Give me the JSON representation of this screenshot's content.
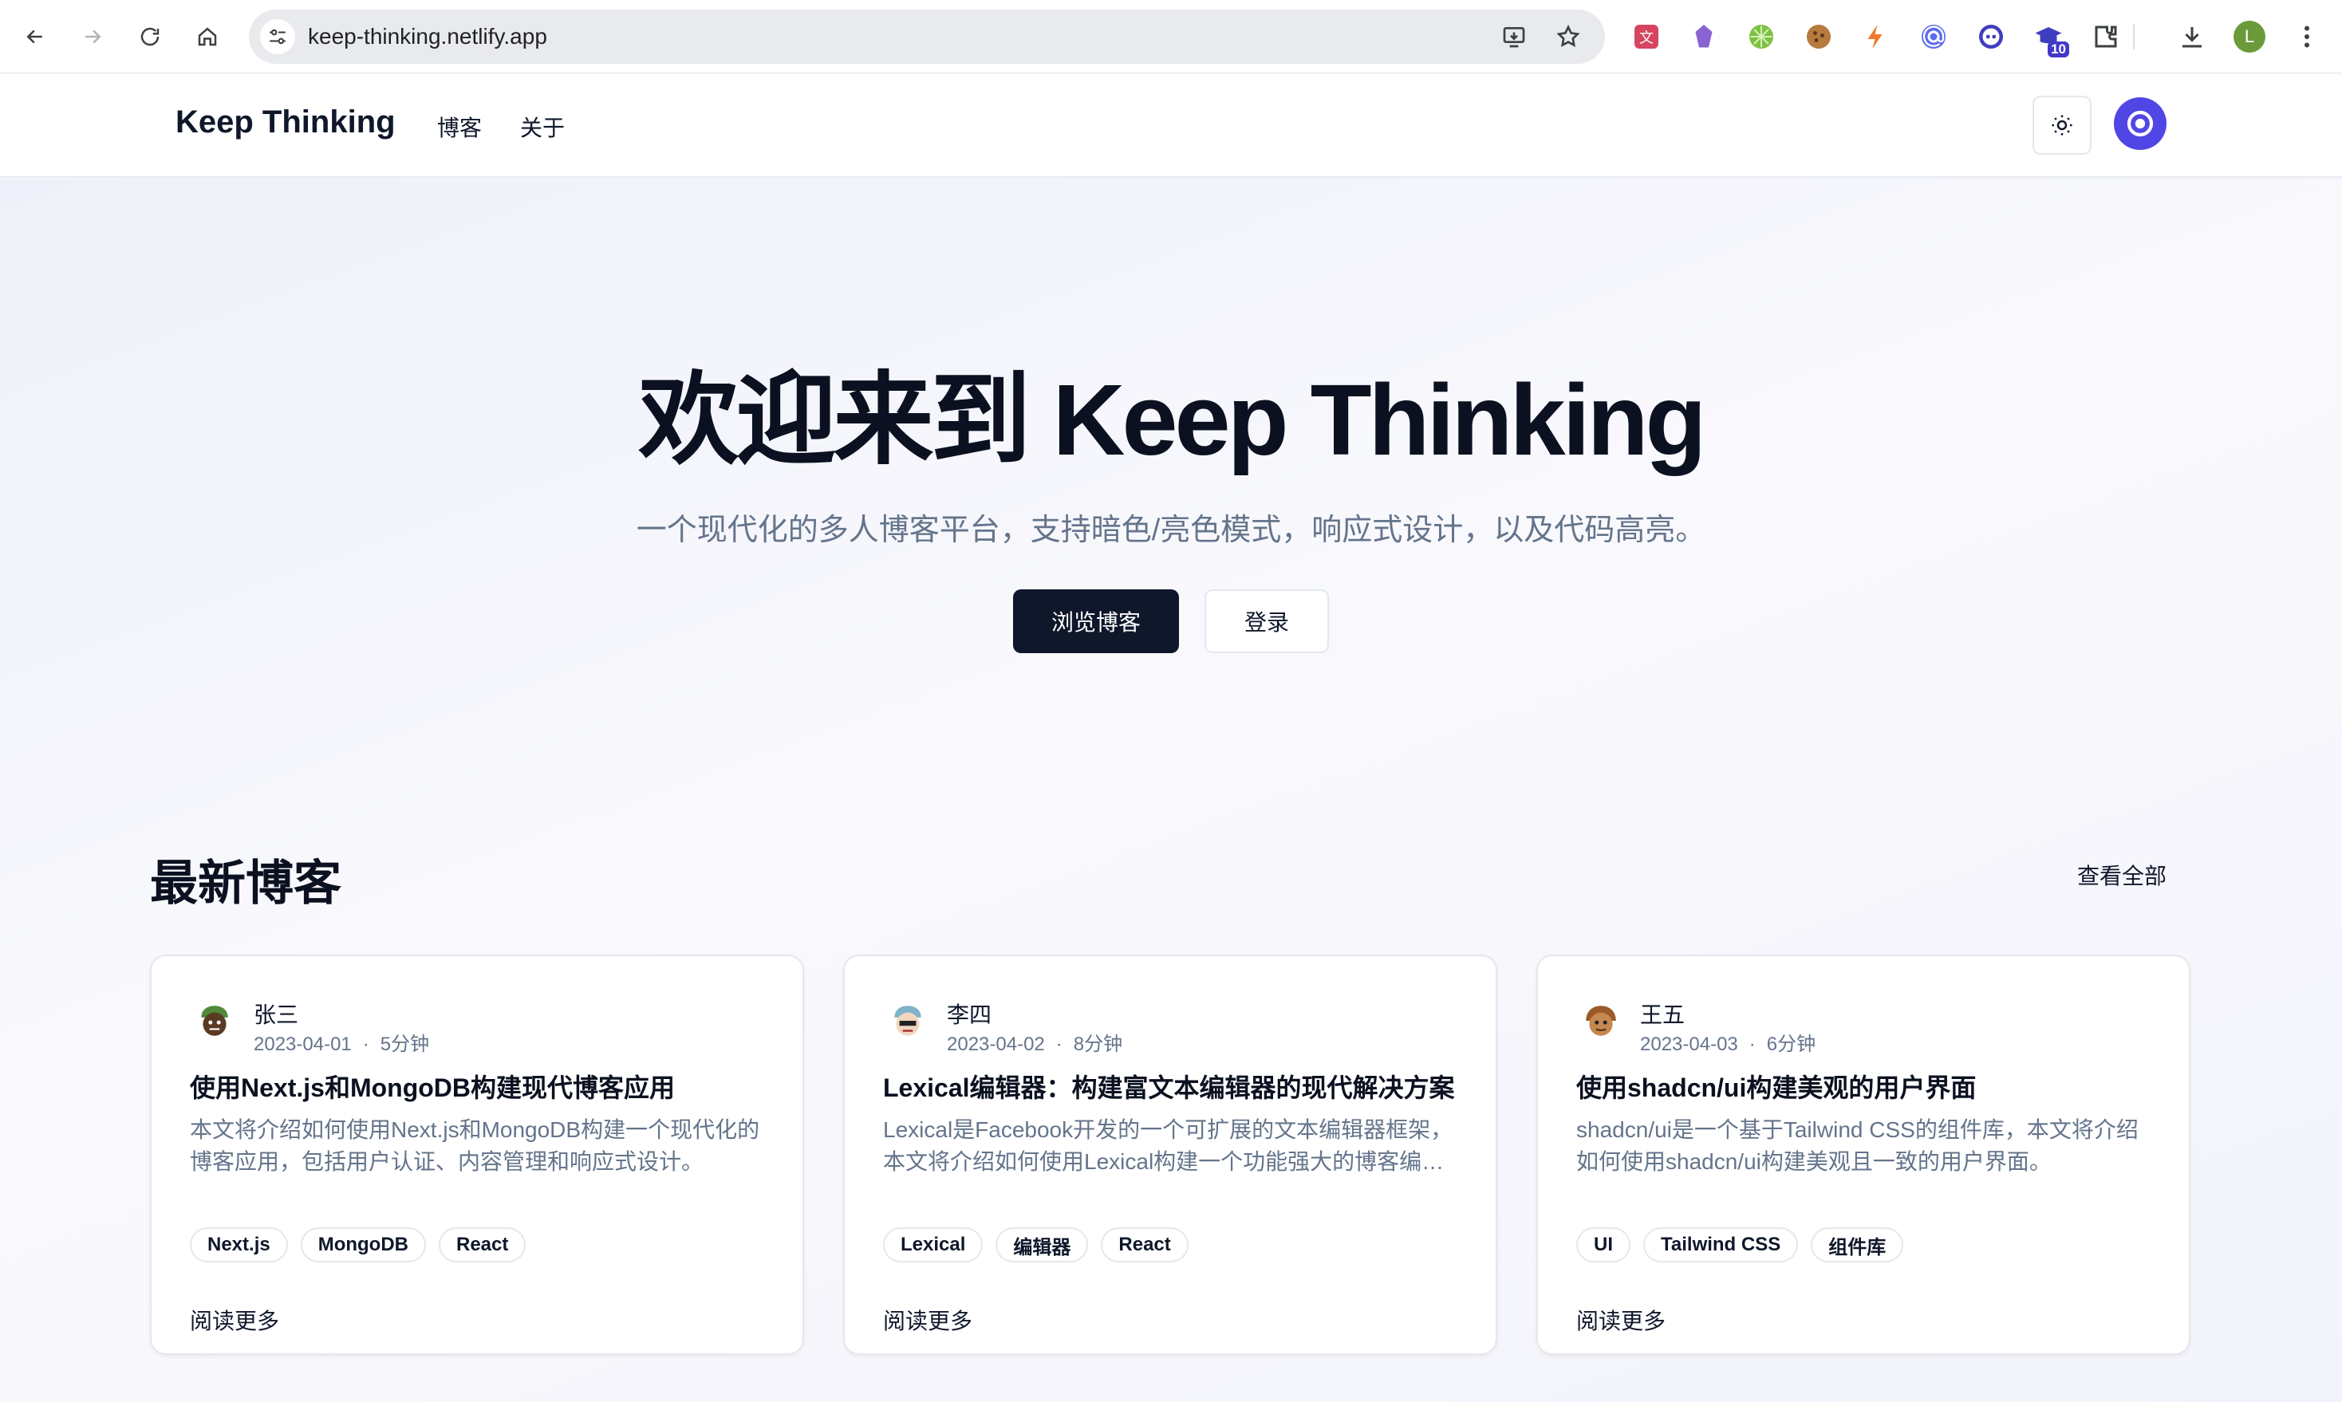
{
  "browser": {
    "url": "keep-thinking.netlify.app",
    "extension_badge": "10",
    "profile_initial": "L"
  },
  "header": {
    "brand": "Keep Thinking",
    "nav": [
      "博客",
      "关于"
    ]
  },
  "hero": {
    "title": "欢迎来到 Keep Thinking",
    "subtitle": "一个现代化的多人博客平台，支持暗色/亮色模式，响应式设计，以及代码高亮。",
    "primary_button": "浏览博客",
    "secondary_button": "登录"
  },
  "latest": {
    "title": "最新博客",
    "view_all": "查看全部",
    "read_more": "阅读更多",
    "posts": [
      {
        "author": "张三",
        "date": "2023-04-01",
        "read_time": "5分钟",
        "title": "使用Next.js和MongoDB构建现代博客应用",
        "excerpt": "本文将介绍如何使用Next.js和MongoDB构建一个现代化的博客应用，包括用户认证、内容管理和响应式设计。",
        "tags": [
          "Next.js",
          "MongoDB",
          "React"
        ],
        "avatar_color": "#4f8a3c"
      },
      {
        "author": "李四",
        "date": "2023-04-02",
        "read_time": "8分钟",
        "title": "Lexical编辑器：构建富文本编辑器的现代解决方案",
        "excerpt": "Lexical是Facebook开发的一个可扩展的文本编辑器框架，本文将介绍如何使用Lexical构建一个功能强大的博客编辑器。",
        "tags": [
          "Lexical",
          "编辑器",
          "React"
        ],
        "avatar_color": "#7fb3c8"
      },
      {
        "author": "王五",
        "date": "2023-04-03",
        "read_time": "6分钟",
        "title": "使用shadcn/ui构建美观的用户界面",
        "excerpt": "shadcn/ui是一个基于Tailwind CSS的组件库，本文将介绍如何使用shadcn/ui构建美观且一致的用户界面。",
        "tags": [
          "UI",
          "Tailwind CSS",
          "组件库"
        ],
        "avatar_color": "#9a5a2a"
      }
    ]
  },
  "colors": {
    "primary": "#0f172a",
    "accent": "#4f46e5",
    "muted": "#64748b"
  }
}
